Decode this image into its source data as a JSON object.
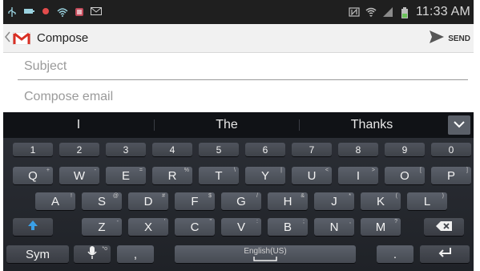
{
  "status_bar": {
    "time": "11:33 AM",
    "left_icons": [
      "usb-icon",
      "battery-saver-icon",
      "red-dot-icon",
      "wifi-icon",
      "notification-icon",
      "email-icon"
    ],
    "right_icons": [
      "nfc-icon",
      "wifi-signal-icon",
      "cell-signal-icon",
      "battery-icon"
    ]
  },
  "action_bar": {
    "title": "Compose",
    "send_label": "SEND"
  },
  "compose": {
    "subject_placeholder": "Subject",
    "body_placeholder": "Compose email"
  },
  "suggestions": [
    "I",
    "The",
    "Thanks"
  ],
  "keyboard": {
    "number_row": [
      "1",
      "2",
      "3",
      "4",
      "5",
      "6",
      "7",
      "8",
      "9",
      "0"
    ],
    "row1": [
      {
        "label": "Q",
        "sub": "+"
      },
      {
        "label": "W",
        "sub": "-"
      },
      {
        "label": "E",
        "sub": "="
      },
      {
        "label": "R",
        "sub": "%"
      },
      {
        "label": "T",
        "sub": "\\"
      },
      {
        "label": "Y",
        "sub": "|"
      },
      {
        "label": "U",
        "sub": "<"
      },
      {
        "label": "I",
        "sub": ">"
      },
      {
        "label": "O",
        "sub": "["
      },
      {
        "label": "P",
        "sub": "]"
      }
    ],
    "row2": [
      {
        "label": "A",
        "sub": "!"
      },
      {
        "label": "S",
        "sub": "@"
      },
      {
        "label": "D",
        "sub": "#"
      },
      {
        "label": "F",
        "sub": "$"
      },
      {
        "label": "G",
        "sub": "/"
      },
      {
        "label": "H",
        "sub": "&"
      },
      {
        "label": "J",
        "sub": "*"
      },
      {
        "label": "K",
        "sub": "("
      },
      {
        "label": "L",
        "sub": ")"
      }
    ],
    "row3": [
      {
        "label": "Z",
        "sub": "-"
      },
      {
        "label": "X",
        "sub": "'"
      },
      {
        "label": "C",
        "sub": "\""
      },
      {
        "label": "V",
        "sub": ":"
      },
      {
        "label": "B",
        "sub": ";"
      },
      {
        "label": "N",
        "sub": ","
      },
      {
        "label": "M",
        "sub": "?"
      }
    ],
    "sym_label": "Sym",
    "comma_label": ",",
    "space_label": "English(US)",
    "period_label": ".",
    "mic_sub": "*o"
  },
  "colors": {
    "status_bar": "#1f1f1f",
    "keyboard_bg": "#2b2e35",
    "key": "#555a63",
    "shift_arrow": "#3aa0e8",
    "gmail_red": "#d93025"
  }
}
